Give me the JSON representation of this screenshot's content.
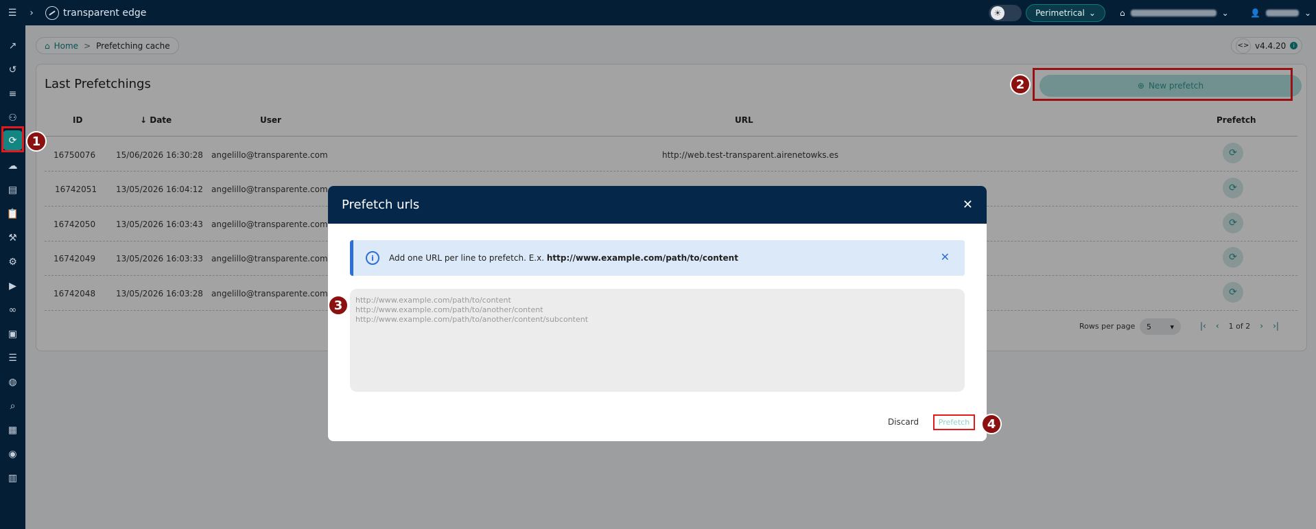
{
  "topbar": {
    "logo_text": "transparent edge",
    "env_label": "Perimetrical",
    "env_chevron": "⌄",
    "org_icon": "building-icon",
    "user_icon": "user-icon"
  },
  "sidebar": {
    "items": [
      "chart-icon",
      "history-icon",
      "list-icon",
      "users-icon",
      "prefetch-icon",
      "cloud-off-icon",
      "server-icon",
      "clipboard-icon",
      "tools-icon",
      "robot-icon",
      "video-icon",
      "voicemail-icon",
      "play-icon",
      "menu-list-icon",
      "globe-icon",
      "search-icon",
      "widgets-icon",
      "support-icon",
      "book-icon"
    ],
    "active_index": 4
  },
  "breadcrumb": {
    "home": "Home",
    "separator": ">",
    "current": "Prefetching cache"
  },
  "version": {
    "label": "v4.4.20",
    "code_glyph": "<>"
  },
  "card": {
    "title": "Last Prefetchings",
    "new_prefetch_label": "New prefetch",
    "columns": {
      "id": "ID",
      "date": "Date",
      "user": "User",
      "url": "URL",
      "prefetch": "Prefetch"
    },
    "rows": [
      {
        "id": "16750076",
        "date": "15/06/2026 16:30:28",
        "user": "angelillo@transparente.com",
        "url": "http://web.test-transparent.airenetowks.es"
      },
      {
        "id": "16742051",
        "date": "13/05/2026 16:04:12",
        "user": "angelillo@transparente.com",
        "url": ""
      },
      {
        "id": "16742050",
        "date": "13/05/2026 16:03:43",
        "user": "angelillo@transparente.com",
        "url": ""
      },
      {
        "id": "16742049",
        "date": "13/05/2026 16:03:33",
        "user": "angelillo@transparente.com",
        "url": ""
      },
      {
        "id": "16742048",
        "date": "13/05/2026 16:03:28",
        "user": "angelillo@transparente.com",
        "url": ""
      }
    ],
    "rows_per_page_label": "Rows per page",
    "rows_per_page_value": "5",
    "page_info": "1 of 2"
  },
  "modal": {
    "title": "Prefetch urls",
    "info_text": "Add one URL per line to prefetch. E.x. ",
    "info_example": "http://www.example.com/path/to/content",
    "textarea_placeholder": "http://www.example.com/path/to/content\nhttp://www.example.com/path/to/another/content\nhttp://www.example.com/path/to/another/content/subcontent",
    "discard_label": "Discard",
    "prefetch_label": "Prefetch"
  },
  "badges": [
    "1",
    "2",
    "3",
    "4"
  ],
  "colors": {
    "navy": "#041e36",
    "teal": "#138583",
    "highlight_red": "#e5181c",
    "badge_red": "#8b1010"
  }
}
